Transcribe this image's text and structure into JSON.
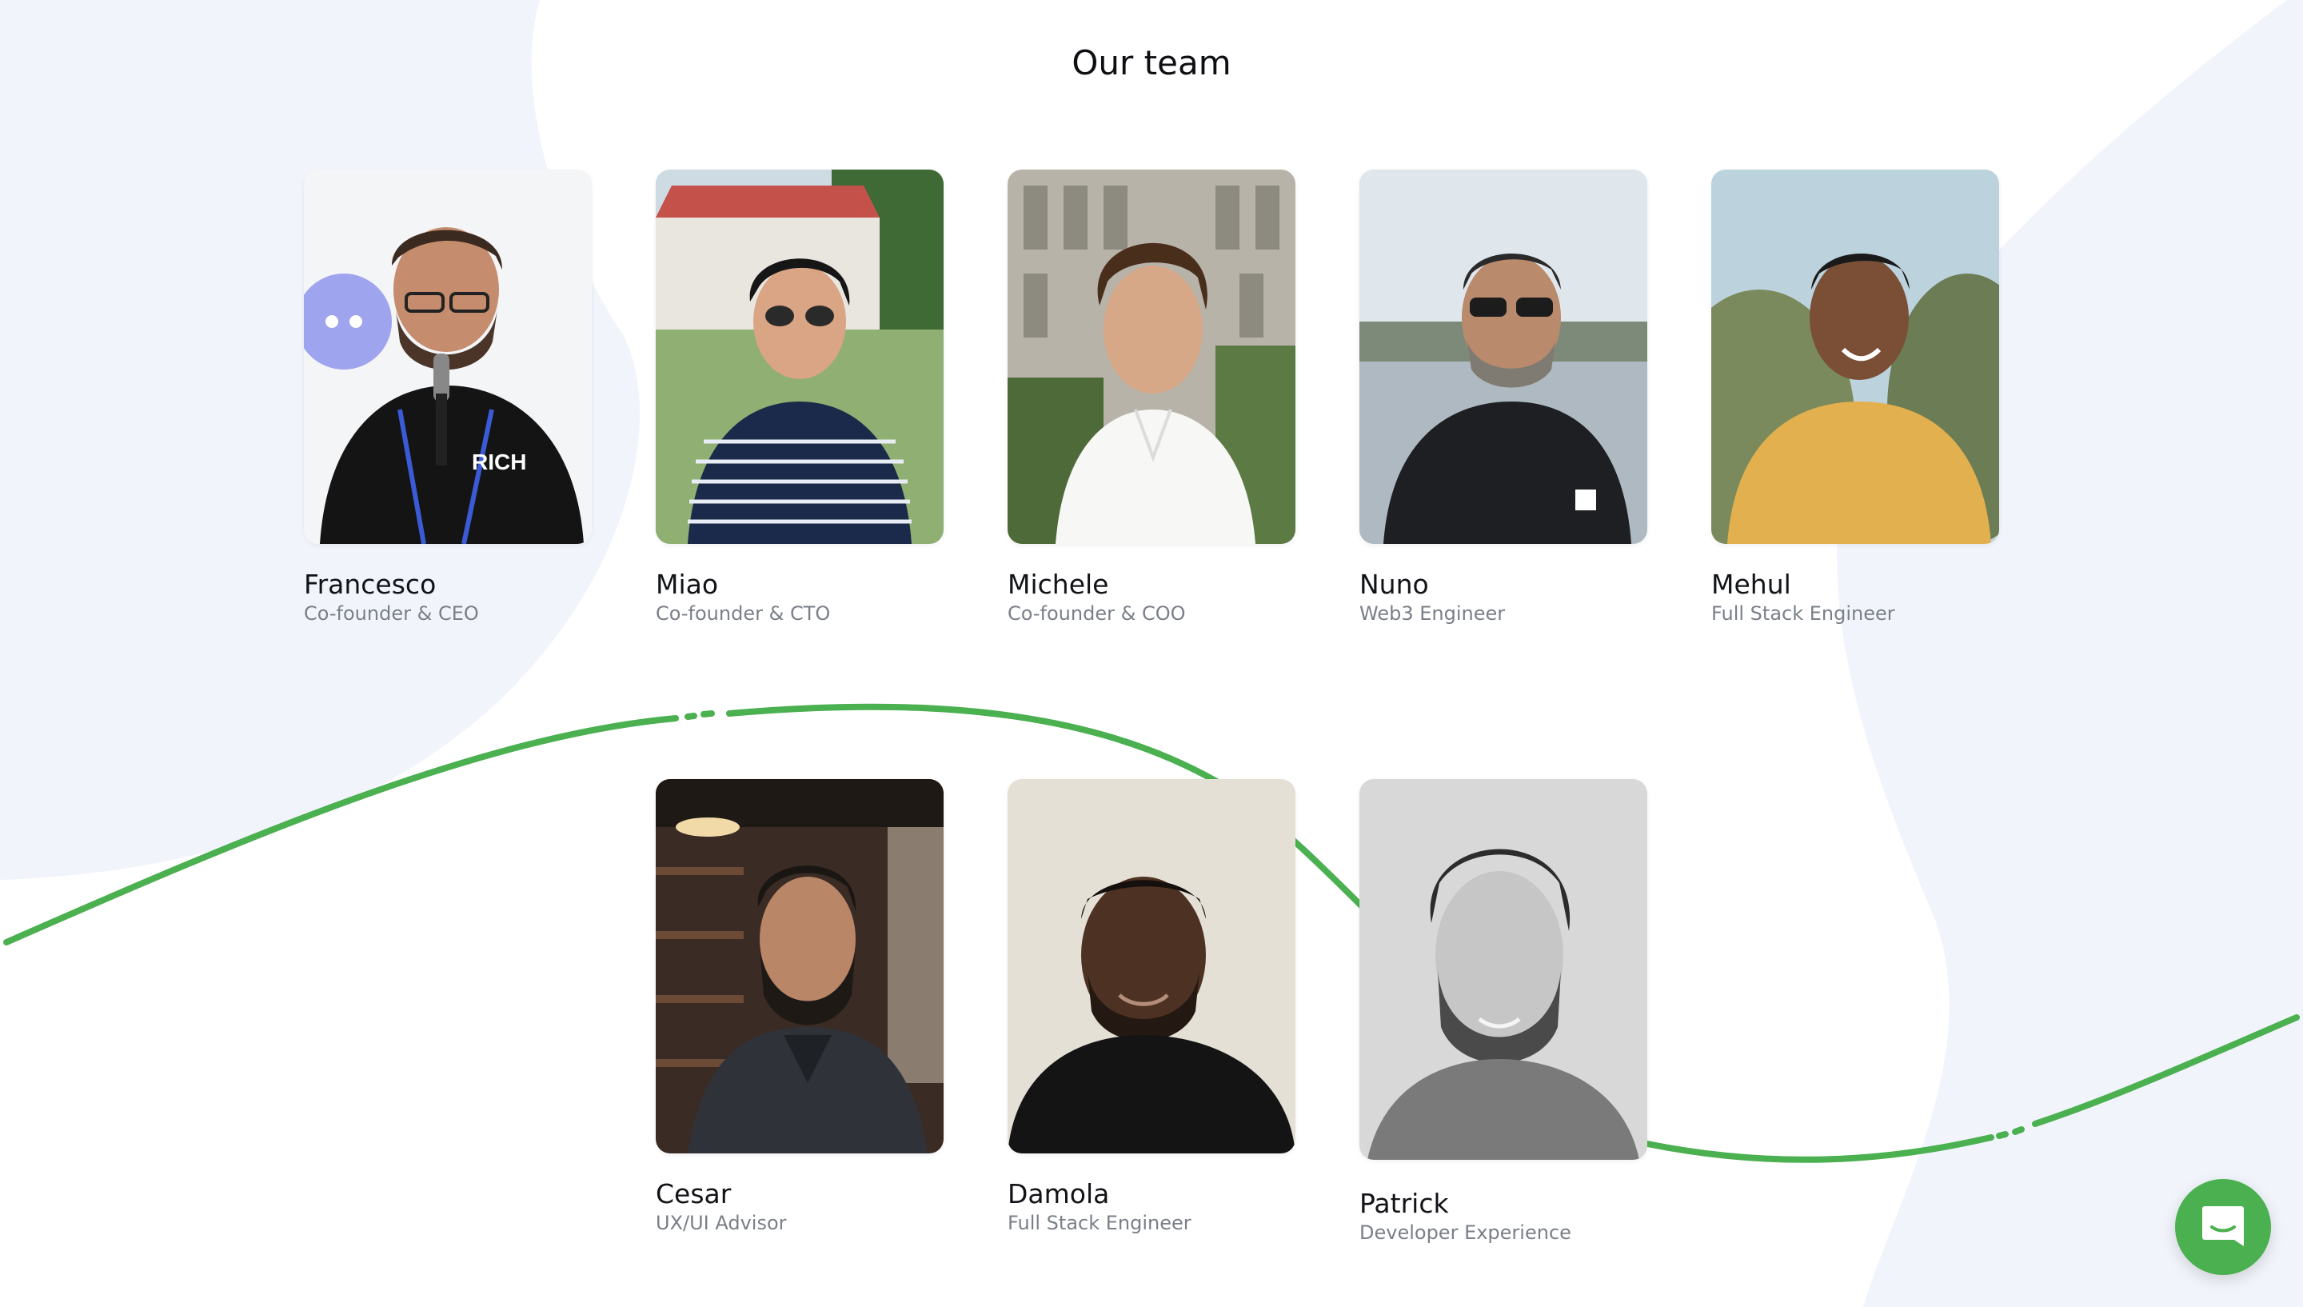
{
  "section": {
    "title": "Our team"
  },
  "colors": {
    "accent": "#4bb04f",
    "background_blob": "#f1f5fb",
    "name_text": "#111317",
    "role_text": "#7a7f88"
  },
  "team": [
    {
      "name": "Francesco",
      "role": "Co-founder & CEO"
    },
    {
      "name": "Miao",
      "role": "Co-founder & CTO"
    },
    {
      "name": "Michele",
      "role": "Co-founder & COO"
    },
    {
      "name": "Nuno",
      "role": "Web3 Engineer"
    },
    {
      "name": "Mehul",
      "role": "Full Stack Engineer"
    },
    {
      "name": "Cesar",
      "role": "UX/UI Advisor"
    },
    {
      "name": "Damola",
      "role": "Full Stack Engineer"
    },
    {
      "name": "Patrick",
      "role": "Developer Experience"
    }
  ],
  "chat": {
    "icon": "chat-bubble-icon"
  }
}
